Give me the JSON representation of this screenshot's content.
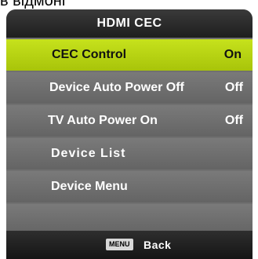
{
  "top_caption": "в відмоні",
  "header": {
    "title": "HDMI CEC"
  },
  "menu": {
    "items": [
      {
        "label": "CEC  Control",
        "value": "On",
        "selected": true
      },
      {
        "label": "Device Auto Power Off",
        "value": "Off",
        "selected": false
      },
      {
        "label": "TV Auto Power On",
        "value": "Off",
        "selected": false
      },
      {
        "label": "Device List",
        "value": "",
        "selected": false
      },
      {
        "label": "Device Menu",
        "value": "",
        "selected": false
      }
    ]
  },
  "footer": {
    "key_label": "MENU",
    "action_label": "Back"
  },
  "colors": {
    "selected_bg": "#b8d414",
    "row_bg": "#6e6e6e",
    "header_bg": "#2a2a2a"
  }
}
